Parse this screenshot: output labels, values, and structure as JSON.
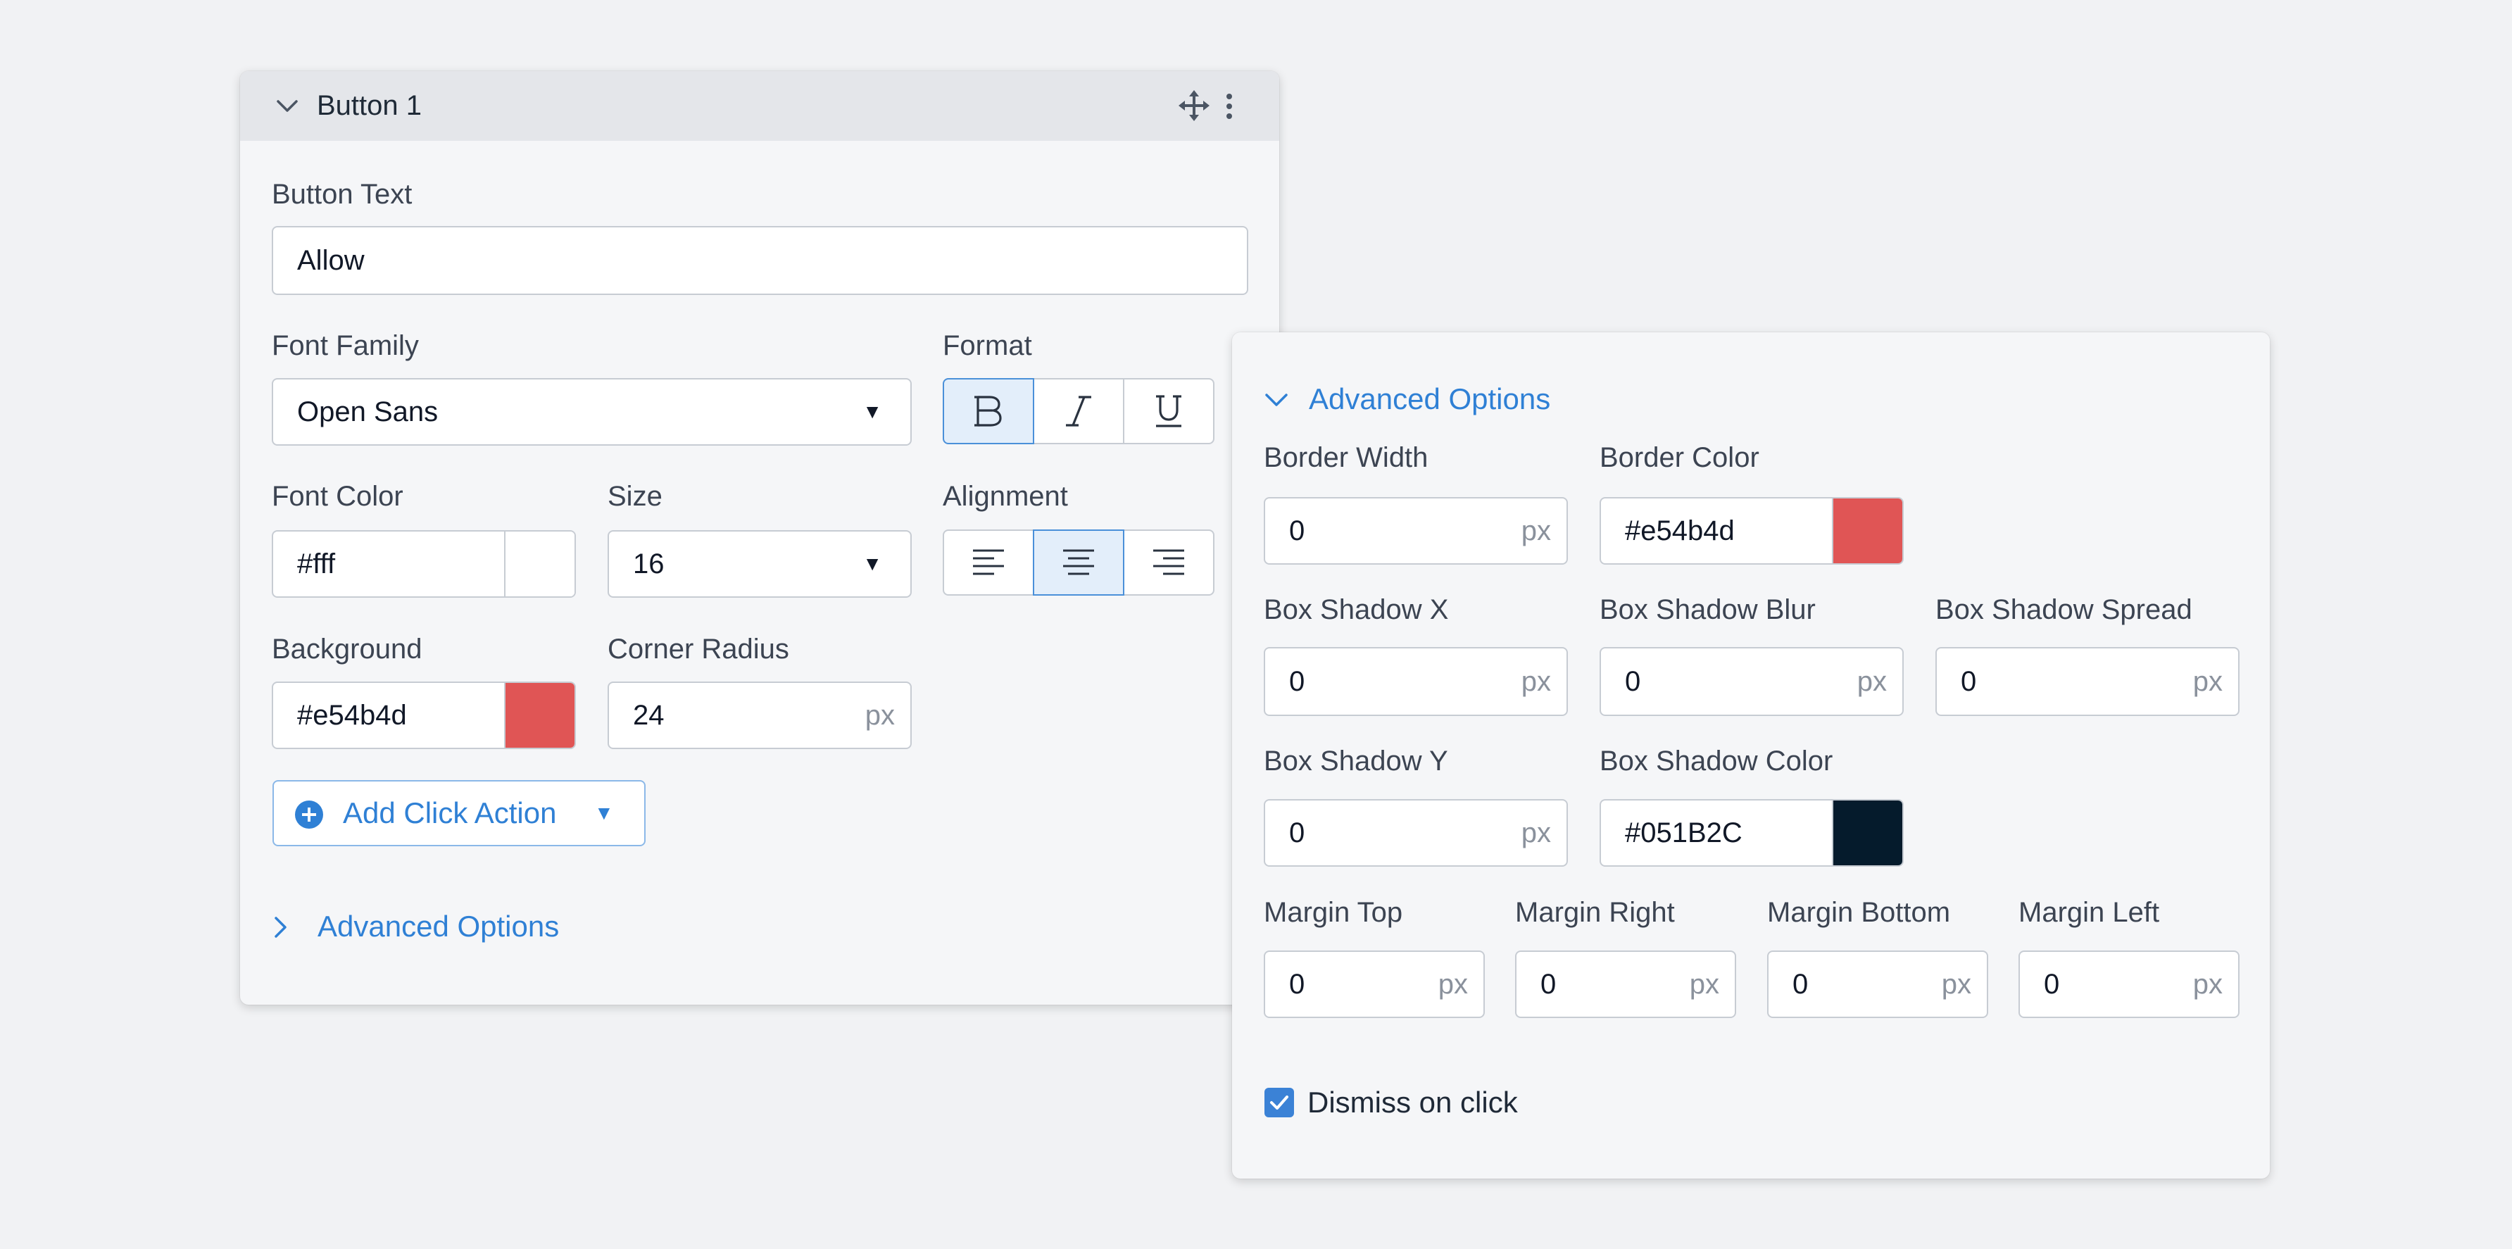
{
  "colors": {
    "accent": "#2f80d5",
    "background_swatch": "#e54b4d",
    "border_swatch": "#e54b4d",
    "shadow_swatch": "#051B2C",
    "font_swatch": "#ffffff"
  },
  "left_panel": {
    "title": "Button 1",
    "header_icons": [
      "chevron-down-icon",
      "move-icon",
      "more-vertical-icon"
    ],
    "button_text": {
      "label": "Button Text",
      "value": "Allow"
    },
    "font_family": {
      "label": "Font Family",
      "value": "Open Sans"
    },
    "format": {
      "label": "Format",
      "buttons": [
        "bold",
        "italic",
        "underline"
      ],
      "active": "bold"
    },
    "font_color": {
      "label": "Font Color",
      "value": "#fff"
    },
    "size": {
      "label": "Size",
      "value": "16"
    },
    "alignment": {
      "label": "Alignment",
      "buttons": [
        "left",
        "center",
        "right"
      ],
      "active": "center"
    },
    "background": {
      "label": "Background",
      "value": "#e54b4d"
    },
    "corner_radius": {
      "label": "Corner Radius",
      "value": "24",
      "unit": "px"
    },
    "add_click_action": "Add Click Action",
    "advanced_options": "Advanced Options"
  },
  "right_panel": {
    "advanced_options": "Advanced Options",
    "border_width": {
      "label": "Border Width",
      "value": "0",
      "unit": "px"
    },
    "border_color": {
      "label": "Border Color",
      "value": "#e54b4d"
    },
    "box_shadow_x": {
      "label": "Box Shadow X",
      "value": "0",
      "unit": "px"
    },
    "box_shadow_blur": {
      "label": "Box Shadow Blur",
      "value": "0",
      "unit": "px"
    },
    "box_shadow_spread": {
      "label": "Box Shadow Spread",
      "value": "0",
      "unit": "px"
    },
    "box_shadow_y": {
      "label": "Box Shadow Y",
      "value": "0",
      "unit": "px"
    },
    "box_shadow_color": {
      "label": "Box Shadow Color",
      "value": "#051B2C"
    },
    "margin_top": {
      "label": "Margin Top",
      "value": "0",
      "unit": "px"
    },
    "margin_right": {
      "label": "Margin Right",
      "value": "0",
      "unit": "px"
    },
    "margin_bottom": {
      "label": "Margin Bottom",
      "value": "0",
      "unit": "px"
    },
    "margin_left": {
      "label": "Margin Left",
      "value": "0",
      "unit": "px"
    },
    "dismiss_on_click": {
      "label": "Dismiss on click",
      "checked": true
    }
  }
}
